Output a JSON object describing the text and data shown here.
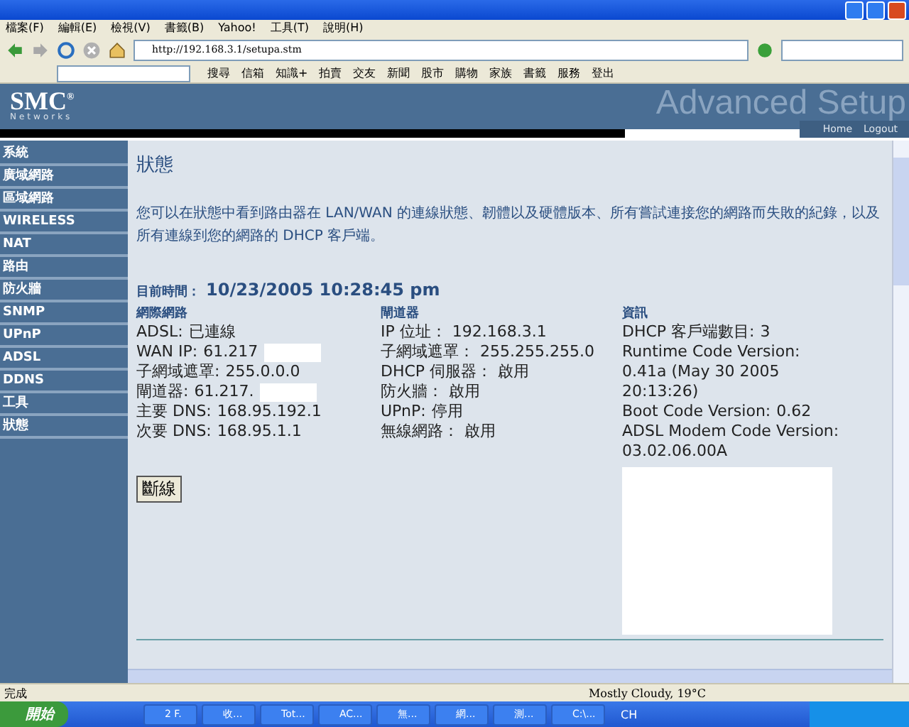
{
  "browser": {
    "menu": [
      "檔案(F)",
      "編輯(E)",
      "檢視(V)",
      "書籤(B)",
      "Yahoo!",
      "工具(T)",
      "說明(H)"
    ],
    "address": "http://192.168.3.1/setupa.stm"
  },
  "yahoo_toolbar": {
    "items": [
      "搜尋",
      "信箱",
      "知識+",
      "拍賣",
      "交友",
      "新聞",
      "股市",
      "購物",
      "家族",
      "書籤",
      "服務",
      "登出"
    ]
  },
  "header": {
    "logo": "SMC",
    "logo_mark": "®",
    "logo_sub": "Networks",
    "banner": "Advanced Setup",
    "links": [
      "Home",
      "Logout"
    ]
  },
  "sidebar": {
    "items": [
      "系統",
      "廣域網路",
      "區域網路",
      "WIRELESS",
      "NAT",
      "路由",
      "防火牆",
      "SNMP",
      "UPnP",
      "ADSL",
      "DDNS",
      "工具",
      "狀態"
    ]
  },
  "page": {
    "title": "狀態",
    "description": "您可以在狀態中看到路由器在 LAN/WAN 的連線狀態、韌體以及硬體版本、所有嘗試連接您的網路而失敗的紀錄，以及所有連線到您的網路的 DHCP 客戶端。",
    "time_label": "目前時間：",
    "time": "10/23/2005 10:28:45 pm",
    "columns": [
      {
        "heading": "網際網路",
        "rows": [
          {
            "label": "ADSL:",
            "value": "已連線"
          },
          {
            "label": "WAN IP:",
            "value": "61.217",
            "redacted": true
          },
          {
            "label": "子網域遮罩:",
            "value": "255.0.0.0"
          },
          {
            "label": "閘道器:",
            "value": "61.217.",
            "redacted": true
          },
          {
            "label": "主要 DNS:",
            "value": "168.95.192.1"
          },
          {
            "label": "次要 DNS:",
            "value": "168.95.1.1"
          }
        ]
      },
      {
        "heading": "閘道器",
        "rows": [
          {
            "label": "IP 位址：",
            "value": "192.168.3.1"
          },
          {
            "label": "子網域遮罩：",
            "value": "255.255.255.0"
          },
          {
            "label": "DHCP 伺服器：",
            "value": "啟用"
          },
          {
            "label": "防火牆：",
            "value": "啟用"
          },
          {
            "label": "UPnP:",
            "value": "停用"
          },
          {
            "label": "無線網路：",
            "value": "啟用"
          }
        ]
      },
      {
        "heading": "資訊",
        "rows": [
          {
            "label": "DHCP 客戶端數目:",
            "value": "3"
          },
          {
            "label": "Runtime Code Version:",
            "value": "0.41a (May 30 2005 20:13:26)"
          },
          {
            "label": "Boot Code Version:",
            "value": "0.62"
          },
          {
            "label": "ADSL Modem Code Version:",
            "value": "03.02.06.00A"
          }
        ]
      }
    ],
    "button": "斷線"
  },
  "status_bar": {
    "text": "完成",
    "weather": "Mostly Cloudy, 19°C"
  },
  "taskbar": {
    "start": "開始",
    "tasks": [
      "2 F.",
      "收...",
      "Tot...",
      "AC...",
      "無...",
      "網...",
      "測...",
      "C:\\..."
    ],
    "language": "CH"
  }
}
